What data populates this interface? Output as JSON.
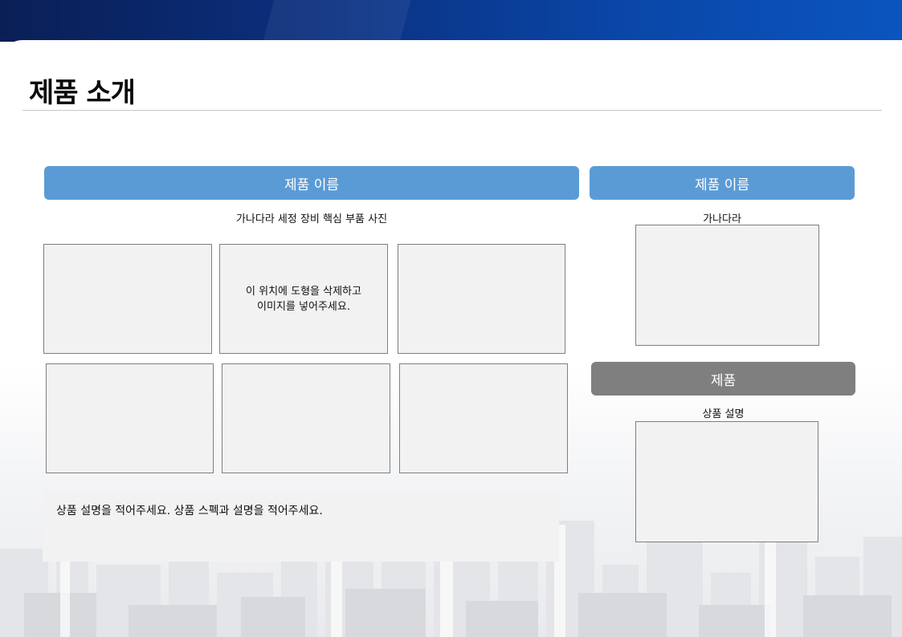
{
  "page": {
    "title": "제품 소개"
  },
  "left_panel": {
    "header": "제품 이름",
    "caption": "가나다라 세정 장비 핵심 부품 사진",
    "placeholder_line1": "이 위치에 도형을 삭제하고",
    "placeholder_line2": "이미지를 넣어주세요.",
    "description": "상품 설명을 적어주세요. 상품 스펙과 설명을 적어주세요."
  },
  "right_panel": {
    "header": "제품 이름",
    "caption": "가나다라",
    "sub_header": "제품",
    "sub_caption": "상품 설명"
  },
  "colors": {
    "header_blue": "#5b9bd5",
    "header_gray": "#7f7f7f",
    "band_dark": "#0a1f55",
    "band_light": "#0b55bf",
    "placeholder_fill": "#f2f2f2"
  }
}
